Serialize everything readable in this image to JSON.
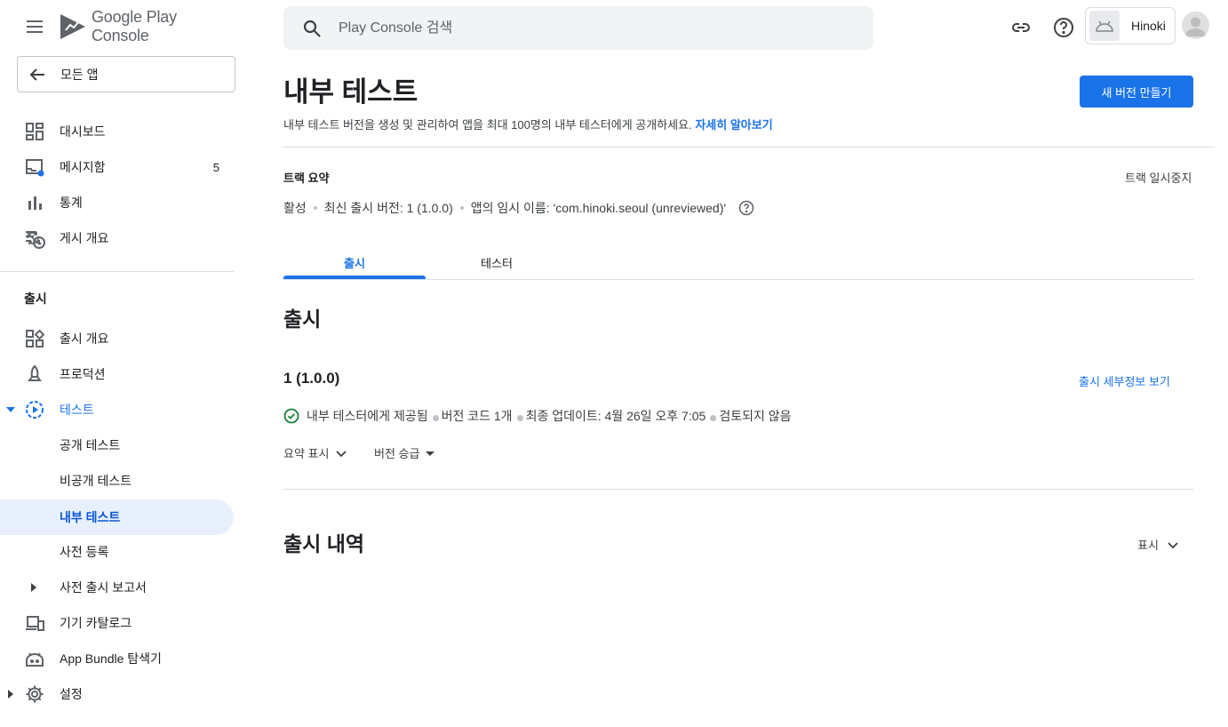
{
  "brand": {
    "google": "Google",
    "play": "Play",
    "console": "Console"
  },
  "sidebar": {
    "all_apps": "모든 앱",
    "main_items": [
      {
        "label": "대시보드",
        "icon": "dashboard-icon"
      },
      {
        "label": "메시지함",
        "icon": "inbox-icon",
        "badge": "5"
      },
      {
        "label": "통계",
        "icon": "bar-chart-icon"
      },
      {
        "label": "게시 개요",
        "icon": "publishing-overview-icon",
        "trailing_icon": "sync-disabled-icon"
      }
    ],
    "release_section": "출시",
    "release_items": [
      {
        "label": "출시 개요",
        "icon": "release-overview-icon"
      },
      {
        "label": "프로덕션",
        "icon": "production-icon"
      },
      {
        "label": "테스트",
        "icon": "testing-icon"
      },
      {
        "label": "공개 테스트"
      },
      {
        "label": "비공개 테스트"
      },
      {
        "label": "내부 테스트"
      },
      {
        "label": "사전 등록"
      },
      {
        "label": "사전 출시 보고서"
      },
      {
        "label": "기기 카탈로그",
        "icon": "device-catalog-icon"
      },
      {
        "label": "App Bundle 탐색기",
        "icon": "app-bundle-icon"
      },
      {
        "label": "설정",
        "icon": "settings-icon"
      }
    ]
  },
  "search": {
    "placeholder": "Play Console 검색"
  },
  "account": {
    "name": "Hinoki"
  },
  "page": {
    "title": "내부 테스트",
    "description": "내부 테스트 버전을 생성 및 관리하여 앱을 최대 100명의 내부 테스터에게 공개하세요.",
    "learn_more": "자세히 알아보기",
    "create_button": "새 버전 만들기"
  },
  "track": {
    "title": "트랙 요약",
    "pause": "트랙 일시중지",
    "status": "활성",
    "latest_version": "최신 출시 버전: 1 (1.0.0)",
    "temp_name": "앱의 임시 이름: 'com.hinoki.seoul (unreviewed)'"
  },
  "tabs": [
    "출시",
    "테스터"
  ],
  "releases": {
    "heading": "출시",
    "version": "1 (1.0.0)",
    "view_details": "출시 세부정보 보기",
    "status_available": "내부 테스터에게 제공됨",
    "version_codes": "버전 코드 1개",
    "last_update": "최종 업데이트: 4월 26일 오후 7:05",
    "review": "검토되지 않음",
    "show_summary": "요약 표시",
    "promote": "버전 승급"
  },
  "history": {
    "heading": "출시 내역",
    "show": "표시"
  },
  "colors": {
    "accent": "#1a73e8",
    "selected_bg": "#e8f0fe",
    "success": "#188038"
  }
}
